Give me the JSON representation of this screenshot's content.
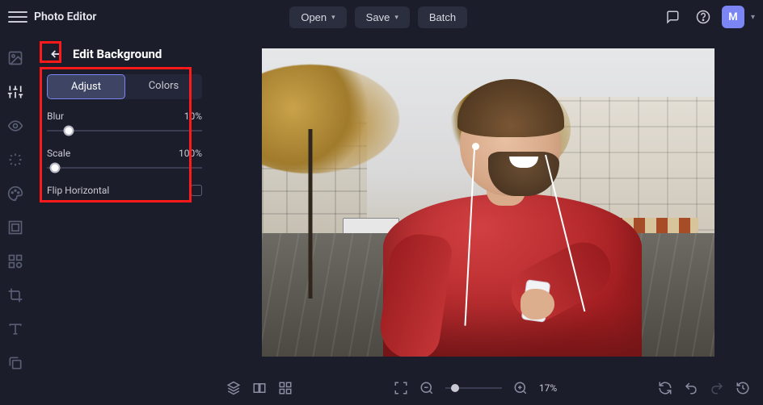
{
  "app": {
    "title": "Photo Editor"
  },
  "topbar": {
    "open_label": "Open",
    "save_label": "Save",
    "batch_label": "Batch",
    "user_initial": "M"
  },
  "panel": {
    "title": "Edit Background",
    "tabs": {
      "adjust": "Adjust",
      "colors": "Colors"
    },
    "blur": {
      "label": "Blur",
      "value": "10%",
      "position_pct": 14
    },
    "scale": {
      "label": "Scale",
      "value": "100%",
      "position_pct": 5
    },
    "flip": {
      "label": "Flip Horizontal",
      "checked": false
    }
  },
  "bottombar": {
    "zoom_pct": "17%"
  }
}
